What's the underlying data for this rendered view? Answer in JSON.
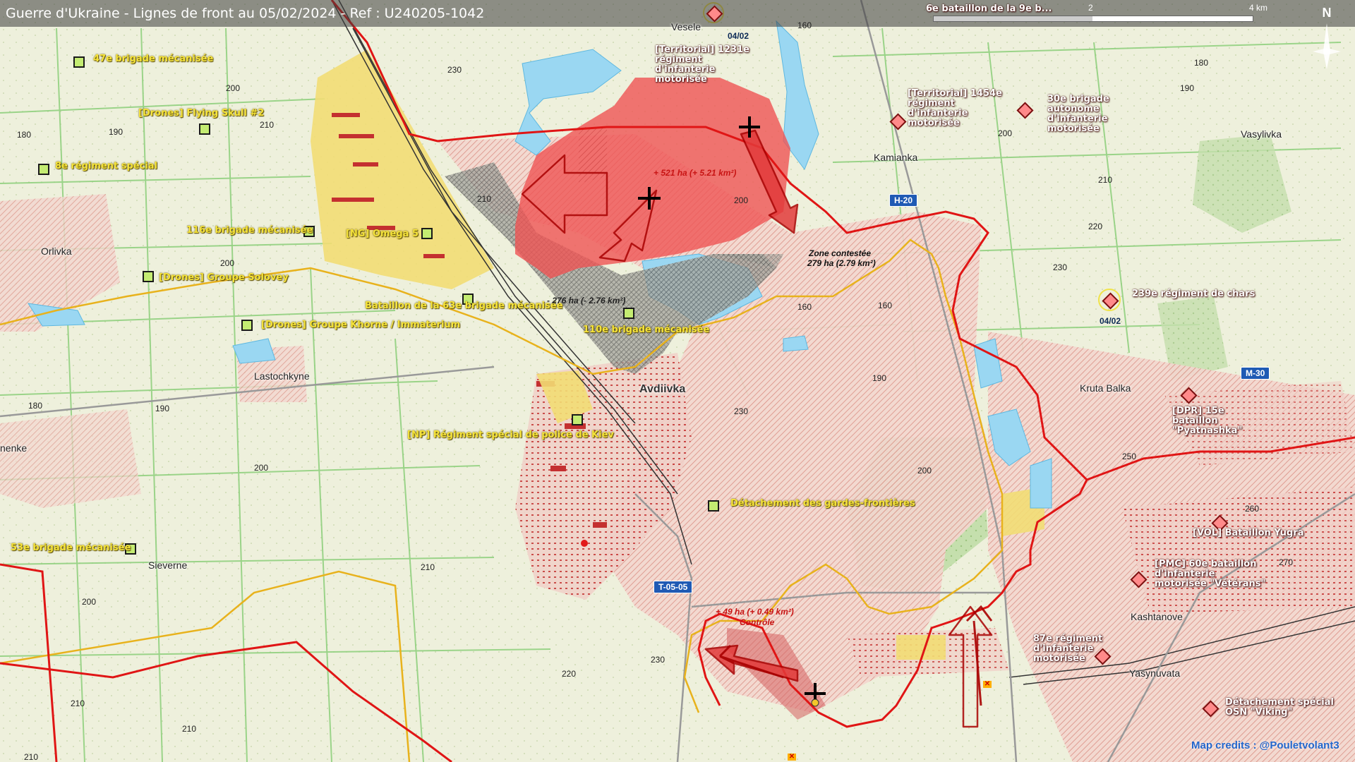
{
  "header": {
    "title": "Guerre d'Ukraine - Lignes de front au 05/02/2024 - Ref : U240205-1042",
    "scale_labels": [
      "0",
      "2",
      "4 km"
    ],
    "north_label": "N"
  },
  "colors": {
    "ukraine_unit_text": "#f5e33a",
    "ukraine_unit_symbol": "#c4ec72",
    "russian_unit_symbol": "#ff8a8a",
    "front_line": "#e01515",
    "russian_gain_fill": "#ef5454",
    "contested_hatch": "#555555",
    "water": "#9ad7f2",
    "road_badge": "#1f5ab4"
  },
  "towns": [
    "Vesele",
    "Kamianka",
    "Vasylivka",
    "Orlivka",
    "Lastochkyne",
    "Avdiivka",
    "Kruta Balka",
    "Sieverne",
    "Kashtanove",
    "Yasynuvata",
    "nenke"
  ],
  "road_badges": [
    "H-20",
    "M-30",
    "T-05-05"
  ],
  "ukraine_units": [
    {
      "label": "47e brigade mécanisée",
      "symbol": "x"
    },
    {
      "label": "[Drones] Flying Skull #2",
      "symbol": ""
    },
    {
      "label": "8e régiment spécial",
      "symbol": ""
    },
    {
      "label": "116e brigade mécanisée",
      "symbol": "x"
    },
    {
      "label": "[NG] Omega 5",
      "symbol": ""
    },
    {
      "label": "[Drones] Groupe Solovey",
      "symbol": "III"
    },
    {
      "label": "Bataillon de la 63e brigade mécanisée",
      "symbol": "II"
    },
    {
      "label": "[Drones] Groupe Khorne / Immaterium",
      "symbol": "III"
    },
    {
      "label": "110e brigade mécanisée",
      "symbol": ""
    },
    {
      "label": "[NP] Régiment spécial de police de Kiev",
      "symbol": "III"
    },
    {
      "label": "Détachement des gardes-frontières",
      "symbol": ""
    },
    {
      "label": "53e brigade mécanisée",
      "symbol": "x"
    }
  ],
  "russian_units": [
    {
      "label": "6e bataillon de la 9e b..."
    },
    {
      "label": "[Territorial] 1231e régiment d'infanterie motorisée"
    },
    {
      "label": "[Territorial] 1454e régiment d'infanterie motorisée"
    },
    {
      "label": "30e brigade autonome d'infanterie motorisée"
    },
    {
      "label": "239e régiment de chars"
    },
    {
      "label": "[DPR] 15e bataillon \"Pyatnashka\""
    },
    {
      "label": "[VOL] Bataillon Yugra"
    },
    {
      "label": "[PMC] 60e bataillon d'infanterie motorisée \"Vétérans\""
    },
    {
      "label": "87e régiment d'infanterie motorisée"
    },
    {
      "label": "Détachement spécial OSN \"Viking\""
    }
  ],
  "dates": [
    "04/02",
    "04/02"
  ],
  "annotations": {
    "gain_north": "+ 521 ha (+ 5.21 km²)",
    "loss_center": "- 276 ha (- 2.76 km²)",
    "zone_title": "Zone contestée",
    "zone_area": "279 ha (2.79 km²)",
    "gain_south": "+ 49 ha (+ 0.49 km²)",
    "gain_south_sub": "Contrôle"
  },
  "elevations": [
    "230",
    "200",
    "210",
    "180",
    "190",
    "210",
    "200",
    "200",
    "160",
    "180",
    "190",
    "200",
    "210",
    "220",
    "230",
    "160",
    "190",
    "230",
    "200",
    "190",
    "180",
    "200",
    "210",
    "200",
    "210",
    "220",
    "230",
    "210",
    "210",
    "190",
    "250",
    "260",
    "270",
    "160"
  ],
  "credits": "Map credits : @Pouletvolant3"
}
